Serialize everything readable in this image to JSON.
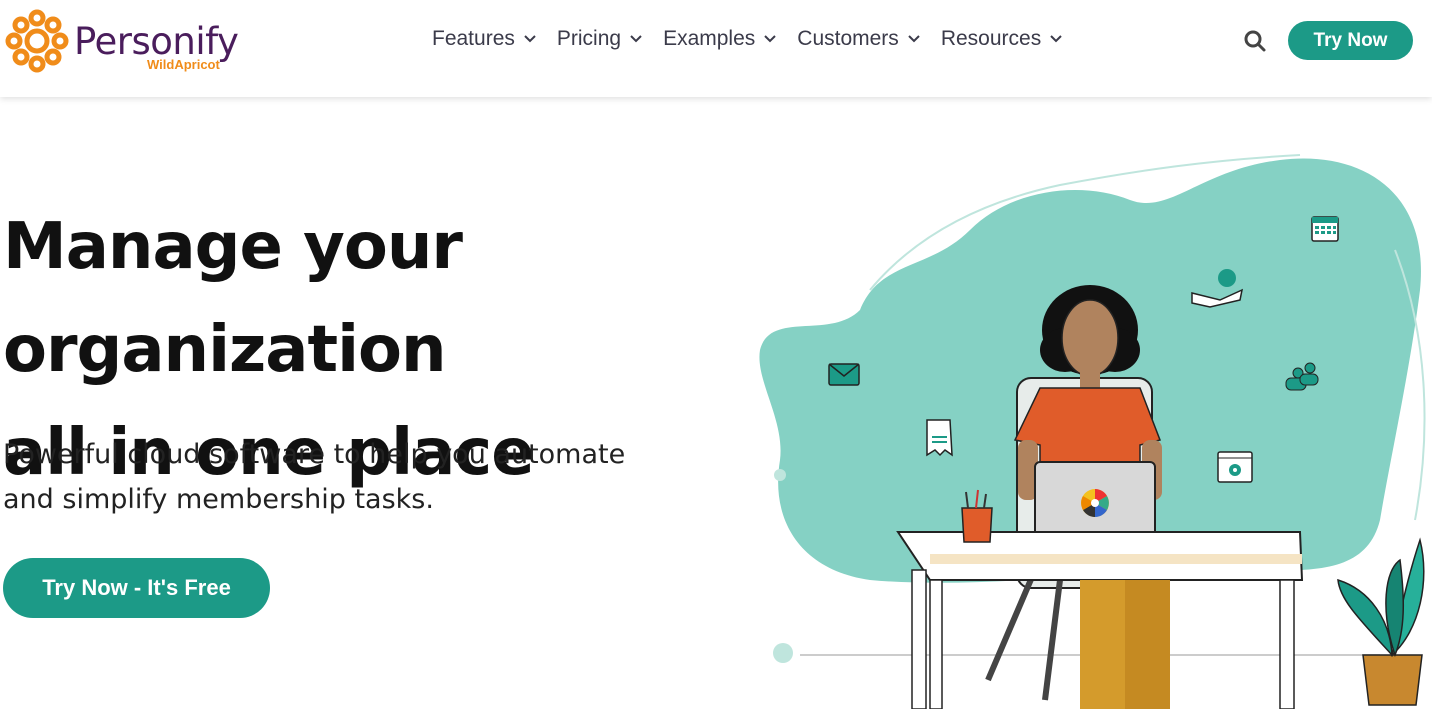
{
  "brand": {
    "name": "Personify",
    "sub": "WildApricot",
    "primary_color": "#4a1d5c",
    "accent_color": "#f08c1a",
    "teal": "#1c9a87"
  },
  "nav": {
    "items": [
      {
        "label": "Features"
      },
      {
        "label": "Pricing"
      },
      {
        "label": "Examples"
      },
      {
        "label": "Customers"
      },
      {
        "label": "Resources"
      }
    ],
    "search_icon": "search-icon",
    "try_label": "Try Now"
  },
  "hero": {
    "title_line1": "Manage your organization",
    "title_line2": "all in one place",
    "subtitle_line1": "Powerful cloud software to help you automate",
    "subtitle_line2": "and simplify membership tasks.",
    "cta_label": "Try Now - It's Free"
  }
}
